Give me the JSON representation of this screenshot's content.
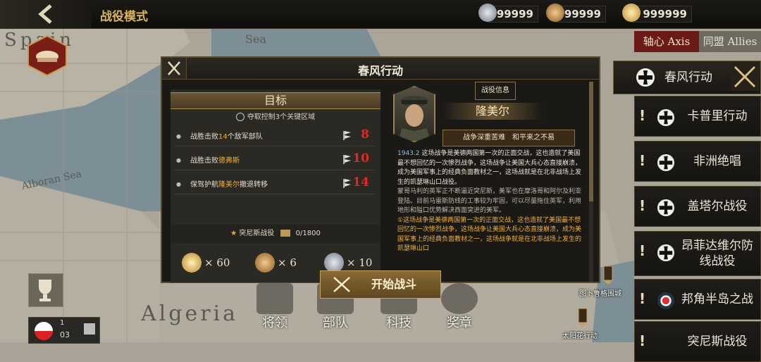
{
  "header": {
    "title": "战役模式"
  },
  "resources": [
    {
      "icon": "silver-medal-icon",
      "value": "99999"
    },
    {
      "icon": "bronze-medal-icon",
      "value": "99999"
    },
    {
      "icon": "gold-star-medal-icon",
      "value": "999999"
    }
  ],
  "factions": {
    "axis": "轴心 Axis",
    "allies": "同盟 Allies"
  },
  "map_labels": {
    "spain": "Spain",
    "sea": "Sea",
    "alboran": "Alboran Sea",
    "algeria": "Algeria"
  },
  "cities": {
    "city1": "图卜鲁格围城",
    "city2": "太阳花行动"
  },
  "campaigns": {
    "selected": "春风行动",
    "items": [
      "卡普里行动",
      "非洲绝唱",
      "盖塔尔战役",
      "昂菲达维尔防线战役",
      "邦角半岛之战",
      "突尼斯战役"
    ]
  },
  "modal": {
    "title": "春风行动",
    "objectives_title": "目标",
    "objective_sub": "夺取控制3个关键区域",
    "objectives": [
      {
        "pre": "战胜击败",
        "hl": "14",
        "post": "个敌军部队",
        "num": "8"
      },
      {
        "pre": "战胜击败",
        "hl": "德弗斯",
        "post": "",
        "num": "10"
      },
      {
        "pre": "保驾护航",
        "hl": "隆美尔",
        "post": "撤退转移",
        "num": "14"
      }
    ],
    "reward_line": {
      "name": "突尼斯战役",
      "progress": "0/1800"
    },
    "rewards": [
      {
        "icon": "gold-star-medal-icon",
        "count": "× 60"
      },
      {
        "icon": "bronze-medal-icon",
        "count": "× 6"
      },
      {
        "icon": "silver-medal-icon",
        "count": "× 10"
      }
    ],
    "info_button": "战役信息",
    "general_name": "隆美尔",
    "general_skill": "战争深重苦难　和平来之不易",
    "desc_year": "1943.2",
    "desc_p1": " 这场战争是美德两国第一次的正面交战，这也造就了美国最不想回忆的一次惨烈战争，这场战争让美国大兵心态直接崩溃，成为美国军事上的经典负面教材之一，这场战就是在北非战场上发生的凯瑟琳山口战役。",
    "desc_p2": "蒙哥马利的英军正不断逼近突尼斯，美军也在摩洛哥和阿尔及利亚登陆。目前马雷斯防线的工事较为牢固，可以尽量拖住英军，利用地形和隘口优势解决西面突进的美军。",
    "desc_p3": "①这场战争是美德两国第一次的正面交战，这也造就了美国最不想回忆的一次惨烈战争，这场战争让美国大兵心态直接崩溃，成为美国军事上的经典负面教材之一，这场战争就是在北非战场上发生的凯瑟琳山口",
    "start_button": "开始战斗"
  },
  "bottom_nav": [
    "将领",
    "部队",
    "科技",
    "奖章"
  ],
  "pager": {
    "current": "1",
    "total": "03"
  }
}
